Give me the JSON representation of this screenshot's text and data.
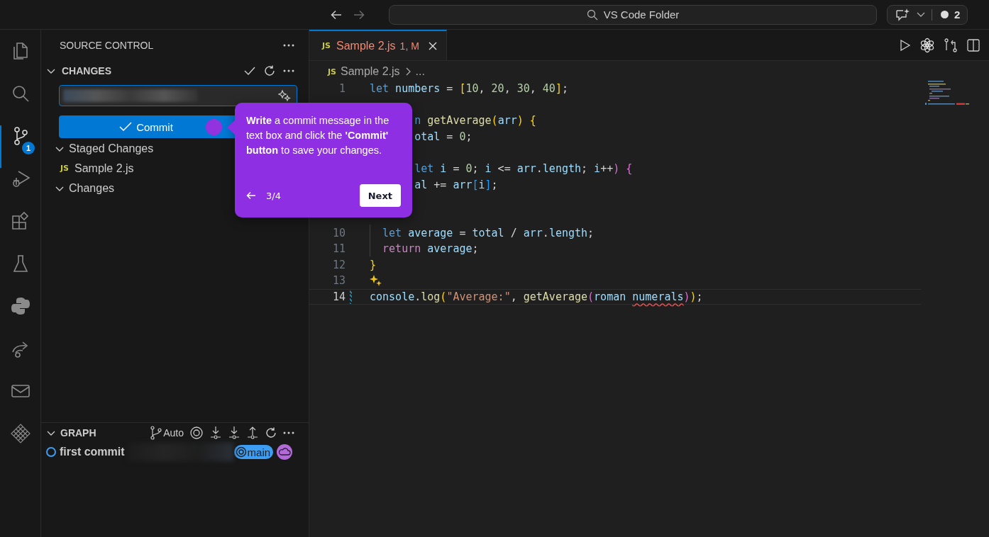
{
  "title_bar": {
    "back_disabled": false,
    "forward_disabled": true,
    "search": "VS Code Folder",
    "notification_count": "2"
  },
  "activity_bar": [
    {
      "selected": false
    },
    {
      "selected": false
    },
    {
      "selected": true,
      "badge": "1"
    },
    {
      "selected": false
    },
    {
      "selected": false
    },
    {
      "selected": false
    },
    {
      "selected": false
    },
    {
      "selected": false
    },
    {
      "selected": false
    },
    {
      "selected": false
    }
  ],
  "sidebar": {
    "title": "SOURCE CONTROL",
    "section": {
      "title": "CHANGES",
      "expanded": true
    },
    "commit_button": "Commit",
    "groups": [
      {
        "label": "Staged Changes",
        "expanded": true,
        "files": [
          {
            "icon": "JS",
            "name": "Sample 2.js"
          }
        ]
      },
      {
        "label": "Changes",
        "expanded": true
      }
    ]
  },
  "graph": {
    "title": "GRAPH",
    "expanded": true,
    "mode": "Auto",
    "commits": [
      {
        "message": "first commit",
        "branch": "main"
      }
    ]
  },
  "editor": {
    "tabs": [
      {
        "icon": "JS",
        "name": "Sample 2.js",
        "status": "1, M",
        "selected": true
      }
    ],
    "breadcrumb": {
      "icon": "JS",
      "file": "Sample 2.js",
      "more": "..."
    },
    "lines": [
      {
        "number": "1",
        "current": false,
        "hint": false,
        "tokens": [
          {
            "text": "let",
            "kind": "kw"
          },
          {
            "text": " numbers",
            "kind": "var"
          },
          {
            "text": " = ",
            "kind": "op"
          },
          {
            "text": "[",
            "kind": "b1"
          },
          {
            "text": "10",
            "kind": "num"
          },
          {
            "text": ", ",
            "kind": "op"
          },
          {
            "text": "20",
            "kind": "num"
          },
          {
            "text": ", ",
            "kind": "op"
          },
          {
            "text": "30",
            "kind": "num"
          },
          {
            "text": ", ",
            "kind": "op"
          },
          {
            "text": "40",
            "kind": "num"
          },
          {
            "text": "]",
            "kind": "b1"
          },
          {
            "text": ";",
            "kind": "op"
          }
        ]
      },
      {
        "current": false,
        "hint": false
      },
      {
        "current": false,
        "hint": false,
        "tokens": [
          {
            "text": "       n",
            "kind": "kw"
          },
          {
            "text": " getAverage",
            "kind": "fn"
          },
          {
            "text": "(",
            "kind": "b1"
          },
          {
            "text": "arr",
            "kind": "var"
          },
          {
            "text": ") {",
            "kind": "b1"
          }
        ]
      },
      {
        "current": false,
        "hint": false,
        "tokens": [
          {
            "text": "       otal",
            "kind": "var"
          },
          {
            "text": " = ",
            "kind": "op"
          },
          {
            "text": "0",
            "kind": "num"
          },
          {
            "text": ";",
            "kind": "op"
          }
        ]
      },
      {
        "current": false,
        "hint": false
      },
      {
        "current": false,
        "hint": false,
        "tokens": [
          {
            "text": "       let",
            "kind": "kw"
          },
          {
            "text": " i",
            "kind": "var"
          },
          {
            "text": " = ",
            "kind": "op"
          },
          {
            "text": "0",
            "kind": "num"
          },
          {
            "text": "; ",
            "kind": "op"
          },
          {
            "text": "i",
            "kind": "var"
          },
          {
            "text": " <= ",
            "kind": "op"
          },
          {
            "text": "arr",
            "kind": "var"
          },
          {
            "text": ".",
            "kind": "op"
          },
          {
            "text": "length",
            "kind": "var"
          },
          {
            "text": "; ",
            "kind": "op"
          },
          {
            "text": "i",
            "kind": "var"
          },
          {
            "text": "++",
            "kind": "op"
          },
          {
            "text": ") {",
            "kind": "b2"
          }
        ]
      },
      {
        "current": false,
        "hint": false,
        "tokens": [
          {
            "text": "       al",
            "kind": "var"
          },
          {
            "text": " += ",
            "kind": "op"
          },
          {
            "text": "arr",
            "kind": "var"
          },
          {
            "text": "[",
            "kind": "b3"
          },
          {
            "text": "i",
            "kind": "var"
          },
          {
            "text": "]",
            "kind": "b3"
          },
          {
            "text": ";",
            "kind": "op"
          }
        ]
      },
      {
        "current": false,
        "hint": false
      },
      {
        "current": false,
        "hint": false
      },
      {
        "number": "10",
        "current": false,
        "hint": false,
        "tokens": [
          {
            "text": "  let",
            "kind": "kw"
          },
          {
            "text": " average",
            "kind": "var"
          },
          {
            "text": " = ",
            "kind": "op"
          },
          {
            "text": "total",
            "kind": "var"
          },
          {
            "text": " / ",
            "kind": "op"
          },
          {
            "text": "arr",
            "kind": "var"
          },
          {
            "text": ".",
            "kind": "op"
          },
          {
            "text": "length",
            "kind": "var"
          },
          {
            "text": ";",
            "kind": "op"
          }
        ]
      },
      {
        "number": "11",
        "current": false,
        "hint": false,
        "tokens": [
          {
            "text": "  return",
            "kind": "ctl"
          },
          {
            "text": " average",
            "kind": "var"
          },
          {
            "text": ";",
            "kind": "op"
          }
        ]
      },
      {
        "number": "12",
        "current": false,
        "hint": false,
        "tokens": [
          {
            "text": "}",
            "kind": "b1"
          }
        ]
      },
      {
        "number": "13",
        "current": false,
        "hint": true
      },
      {
        "number": "14",
        "current": true,
        "hint": false,
        "tokens": [
          {
            "text": "console",
            "kind": "var"
          },
          {
            "text": ".",
            "kind": "op"
          },
          {
            "text": "log",
            "kind": "fn"
          },
          {
            "text": "(",
            "kind": "b1"
          },
          {
            "text": "\"Average:\"",
            "kind": "str"
          },
          {
            "text": ", ",
            "kind": "op"
          },
          {
            "text": "getAverage",
            "kind": "fn"
          },
          {
            "text": "(",
            "kind": "b2"
          },
          {
            "text": "roman ",
            "kind": "var"
          },
          {
            "text": "numerals",
            "kind": "err"
          },
          {
            "text": ")",
            "kind": "b2"
          },
          {
            "text": ")",
            "kind": "b1"
          },
          {
            "text": ";",
            "kind": "op"
          }
        ]
      }
    ]
  },
  "tour_popup": {
    "text": "**Write** a commit message in the text box and click the **'Commit' button** to save your changes.",
    "step": "3/4",
    "next_button": "Next"
  }
}
